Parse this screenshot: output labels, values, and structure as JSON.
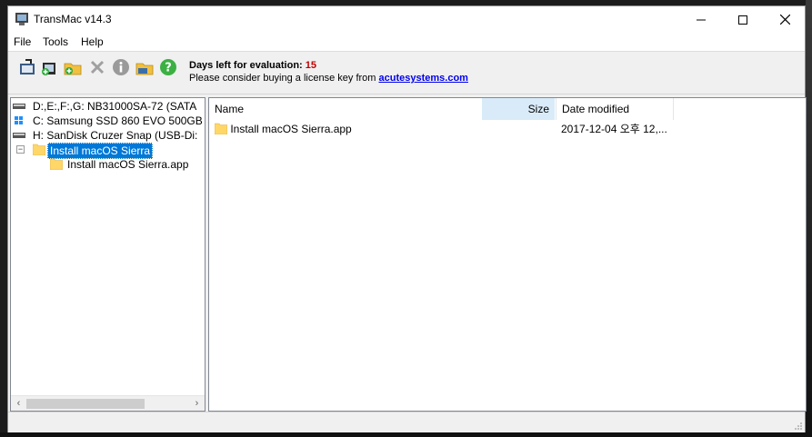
{
  "window": {
    "title": "TransMac v14.3"
  },
  "menu": [
    "File",
    "Tools",
    "Help"
  ],
  "toolbar": {
    "buttons": [
      {
        "icon": "open-disk-image-icon"
      },
      {
        "icon": "new-disk-image-icon"
      },
      {
        "icon": "new-folder-icon"
      },
      {
        "icon": "delete-icon"
      },
      {
        "icon": "info-icon"
      },
      {
        "icon": "open-folder-icon"
      },
      {
        "icon": "help-icon"
      }
    ],
    "eval_label": "Days left for evaluation: ",
    "eval_days": "15",
    "license_text": "Please consider buying a license key from ",
    "license_link": "acutesystems.com"
  },
  "tree": {
    "drives": [
      {
        "label": "D:,E:,F:,G:  NB31000SA-72 (SATA"
      },
      {
        "label": "C:  Samsung SSD 860 EVO 500GB"
      },
      {
        "label": "H: SanDisk Cruzer Snap (USB-Di:"
      }
    ],
    "selected_folder": "Install macOS Sierra",
    "child_folder": "Install macOS Sierra.app"
  },
  "list": {
    "columns": {
      "name": "Name",
      "size": "Size",
      "date": "Date modified"
    },
    "rows": [
      {
        "name": "Install macOS Sierra.app",
        "size": "",
        "date": "2017-12-04 오후 12,..."
      }
    ]
  },
  "colors": {
    "selection": "#0078d7",
    "folder": "#ffd768",
    "link": "#0000ee",
    "days": "#c00000"
  }
}
